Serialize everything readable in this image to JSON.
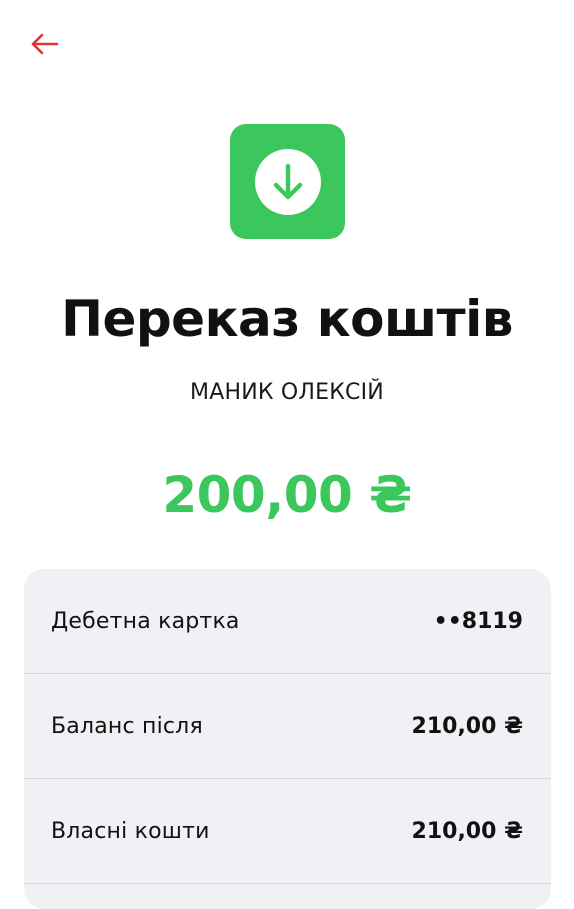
{
  "colors": {
    "accent_green": "#3cc75c",
    "back_arrow_red": "#e0323c",
    "card_bg": "#f1f1f5"
  },
  "header": {
    "back_icon": "arrow-left-icon"
  },
  "transaction": {
    "icon": "arrow-down-icon",
    "title": "Переказ коштів",
    "counterparty": "МАНИК ОЛЕКСІЙ",
    "amount": "200,00 ₴"
  },
  "details": [
    {
      "label": "Дебетна картка",
      "value": "••8119"
    },
    {
      "label": "Баланс після",
      "value": "210,00 ₴"
    },
    {
      "label": "Власні кошти",
      "value": "210,00 ₴"
    }
  ]
}
